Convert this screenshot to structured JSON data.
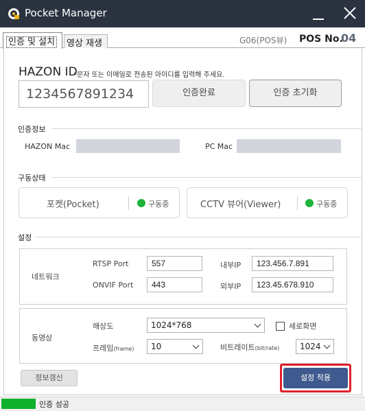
{
  "window": {
    "title": "Pocket Manager",
    "icons": {
      "app": "pocket-logo-icon",
      "minimize": "minimize-icon",
      "close": "close-icon"
    }
  },
  "tabs": [
    {
      "label": "인증 및 설치",
      "active": true
    },
    {
      "label": "영상 재생",
      "active": false
    }
  ],
  "header_info": {
    "device": "G06(POS뷰)",
    "pos_label": "POS No.",
    "pos_number": "04"
  },
  "auth": {
    "title": "HAZON ID",
    "note": "*문자 또는 이메일로 전송된 아이디를 입력해 주세요.",
    "id_value": "1234567891234",
    "confirm_button": "인증완료",
    "reset_button": "인증 초기화"
  },
  "auth_info": {
    "section_title": "인증정보",
    "hazon_mac_label": "HAZON Mac",
    "pc_mac_label": "PC Mac"
  },
  "run_status": {
    "section_title": "구동상태",
    "items": [
      {
        "name": "포켓(Pocket)",
        "status": "구동중",
        "color": "#1fb33a"
      },
      {
        "name": "CCTV 뷰어(Viewer)",
        "status": "구동중",
        "color": "#1fb33a"
      }
    ]
  },
  "settings": {
    "section_title": "설정",
    "network": {
      "label": "네트워크",
      "rtsp_label": "RTSP Port",
      "rtsp_value": "557",
      "onvif_label": "ONVIF Port",
      "onvif_value": "443",
      "internal_ip_label": "내부IP",
      "internal_ip_value": "123.456.7.891",
      "external_ip_label": "외부IP",
      "external_ip_value": "123.45.678.910"
    },
    "video": {
      "label": "동영상",
      "resolution_label": "해상도",
      "resolution_value": "1024*768",
      "portrait_label": "세로화면",
      "portrait_checked": false,
      "frame_label": "프레임",
      "frame_unit": "(frame)",
      "frame_value": "10",
      "bitrate_label": "비트레이트",
      "bitrate_unit": "(bit/rate)",
      "bitrate_value": "1024"
    }
  },
  "actions": {
    "refresh": "정보갱신",
    "apply": "설정 적용"
  },
  "statusbar": {
    "message": "인증 성공",
    "progress": 1.0
  },
  "colors": {
    "titlebar": "#2b3341",
    "apply_button": "#3e5a8e",
    "highlight": "#e0202a",
    "running": "#1fb33a"
  }
}
